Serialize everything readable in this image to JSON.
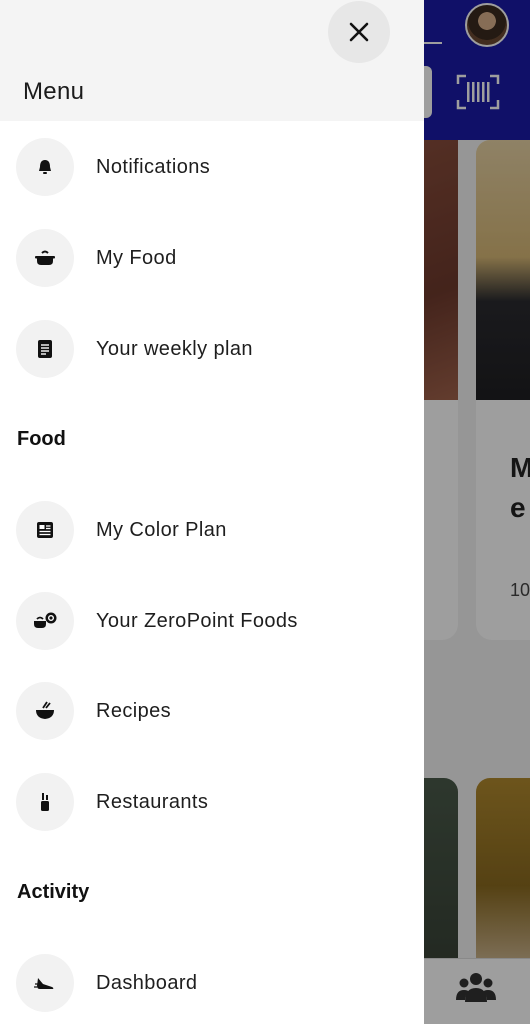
{
  "drawer": {
    "title": "Menu",
    "close_icon": "close-icon",
    "items_top": [
      {
        "label": "Notifications",
        "icon": "bell-icon"
      },
      {
        "label": "My Food",
        "icon": "pot-icon"
      },
      {
        "label": "Your weekly plan",
        "icon": "document-list-icon"
      }
    ],
    "section_food": "Food",
    "items_food": [
      {
        "label": "My Color Plan",
        "icon": "color-plan-icon"
      },
      {
        "label": "Your ZeroPoint Foods",
        "icon": "zeropoint-icon"
      },
      {
        "label": "Recipes",
        "icon": "bowl-icon"
      },
      {
        "label": "Restaurants",
        "icon": "utensils-icon"
      }
    ],
    "section_activity": "Activity",
    "items_activity": [
      {
        "label": "Dashboard",
        "icon": "sneaker-icon"
      }
    ]
  },
  "background": {
    "card_title_fragment": "M\ne",
    "card_number_fragment": "10",
    "accent_color": "#1a1aa8"
  }
}
